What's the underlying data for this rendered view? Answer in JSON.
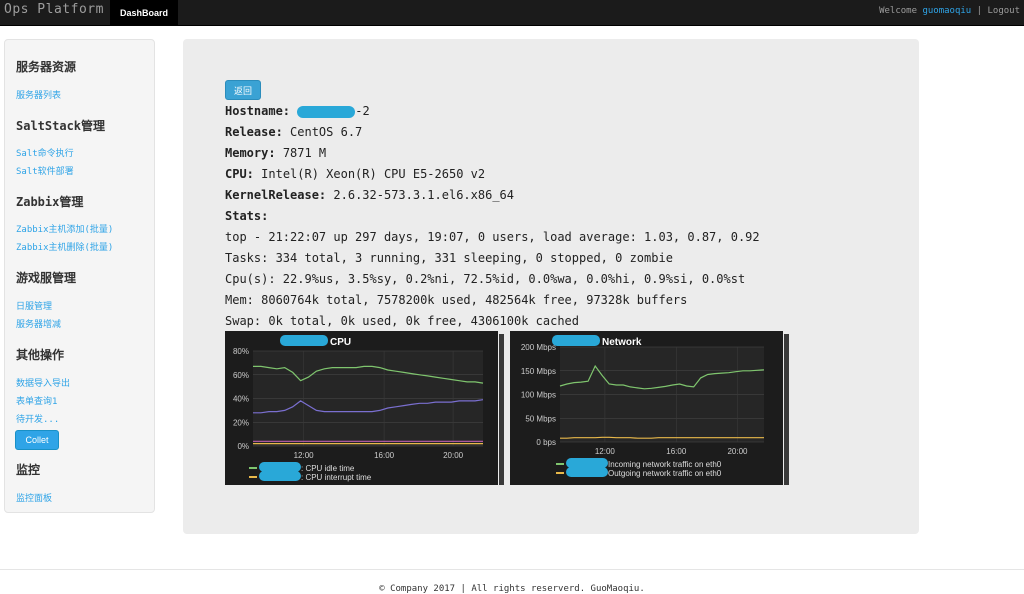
{
  "nav": {
    "brand": "Ops Platform",
    "tab": "DashBoard",
    "welcome": "Welcome",
    "user": "guomaoqiu",
    "separator": "|",
    "logout": "Logout"
  },
  "sidebar": {
    "sections": [
      {
        "title": "服务器资源",
        "links": [
          "服务器列表"
        ]
      },
      {
        "title": "SaltStack管理",
        "links": [
          "Salt命令执行",
          "Salt软件部署"
        ]
      },
      {
        "title": "Zabbix管理",
        "links": [
          "Zabbix主机添加(批量)",
          "Zabbix主机删除(批量)"
        ]
      },
      {
        "title": "游戏服管理",
        "links": [
          "日服管理",
          "服务器增减"
        ]
      },
      {
        "title": "其他操作",
        "links": [
          "数据导入导出",
          "表单查询1",
          "待开发..."
        ]
      },
      {
        "title": "监控",
        "links": [
          "监控面板"
        ]
      }
    ],
    "button": "Collet"
  },
  "main": {
    "back_button": "返回",
    "hostname_label": "Hostname:",
    "hostname_suffix": "-2",
    "release_label": "Release:",
    "release": "CentOS 6.7",
    "memory_label": "Memory:",
    "memory": "7871 M",
    "cpu_label": "CPU:",
    "cpu": "Intel(R) Xeon(R) CPU E5-2650 v2",
    "kernel_label": "KernelRelease:",
    "kernel": "2.6.32-573.3.1.el6.x86_64",
    "stats_label": "Stats:",
    "stats": [
      "top - 21:22:07 up 297 days, 19:07, 0 users, load average: 1.03, 0.87, 0.92",
      "Tasks: 334 total, 3 running, 331 sleeping, 0 stopped, 0 zombie",
      "Cpu(s): 22.9%us, 3.5%sy, 0.2%ni, 72.5%id, 0.0%wa, 0.0%hi, 0.9%si, 0.0%st",
      "Mem: 8060764k total, 7578200k used, 482564k free, 97328k buffers",
      "Swap: 0k total, 0k used, 0k free, 4306100k cached"
    ]
  },
  "chart_data": [
    {
      "type": "line",
      "title": "CPU",
      "x_ticks": [
        "12:00",
        "16:00",
        "20:00"
      ],
      "y_ticks": [
        "80%",
        "60%",
        "40%",
        "20%",
        "0%"
      ],
      "ylim": [
        0,
        80
      ],
      "series": [
        {
          "name": ": CPU idle time",
          "color": "#7fc56e",
          "values": [
            67,
            67,
            66,
            65,
            66,
            62,
            55,
            58,
            63,
            65,
            66,
            66,
            66,
            66,
            67,
            67,
            66,
            64,
            63,
            62,
            61,
            60,
            59,
            58,
            57,
            56,
            55,
            54,
            54,
            53
          ]
        },
        {
          "name": ": CPU interrupt time",
          "color": "#e8b84a",
          "values": [
            2,
            2,
            2,
            2,
            2,
            2,
            2,
            2,
            2,
            2,
            2,
            2,
            2,
            2,
            2,
            2,
            2,
            2,
            2,
            2,
            2,
            2,
            2,
            2,
            2,
            2,
            2,
            2,
            2,
            2
          ]
        },
        {
          "name": "",
          "color": "#7a6fd0",
          "values": [
            28,
            28,
            29,
            29,
            30,
            33,
            38,
            34,
            30,
            29,
            29,
            29,
            29,
            29,
            29,
            29,
            30,
            32,
            33,
            34,
            35,
            36,
            36,
            37,
            37,
            37,
            38,
            38,
            38,
            39
          ]
        },
        {
          "name": "",
          "color": "#c060b0",
          "values": [
            4,
            4,
            4,
            4,
            4,
            4,
            4,
            4,
            4,
            4,
            4,
            4,
            4,
            4,
            4,
            4,
            4,
            4,
            4,
            4,
            4,
            4,
            4,
            4,
            4,
            4,
            4,
            4,
            4,
            4
          ]
        }
      ],
      "legend": "bottom"
    },
    {
      "type": "line",
      "title": "Network",
      "x_ticks": [
        "12:00",
        "16:00",
        "20:00"
      ],
      "y_ticks": [
        "200 Mbps",
        "150 Mbps",
        "100 Mbps",
        "50 Mbps",
        "0 bps"
      ],
      "ylim": [
        0,
        200
      ],
      "series": [
        {
          "name": "Incoming network traffic on eth0",
          "color": "#7fc56e",
          "values": [
            118,
            122,
            125,
            126,
            128,
            160,
            140,
            122,
            120,
            120,
            116,
            114,
            112,
            113,
            115,
            117,
            120,
            122,
            118,
            116,
            135,
            142,
            144,
            145,
            146,
            148,
            150,
            150,
            151,
            152
          ]
        },
        {
          "name": "Outgoing network traffic on eth0",
          "color": "#e8b84a",
          "values": [
            8,
            8,
            9,
            9,
            9,
            9,
            10,
            10,
            9,
            9,
            9,
            8,
            8,
            8,
            9,
            9,
            9,
            9,
            9,
            9,
            9,
            9,
            9,
            9,
            9,
            9,
            9,
            9,
            9,
            9
          ]
        }
      ],
      "legend": "bottom"
    }
  ],
  "footer": "© Company 2017 | All rights reserverd. GuoMaoqiu."
}
